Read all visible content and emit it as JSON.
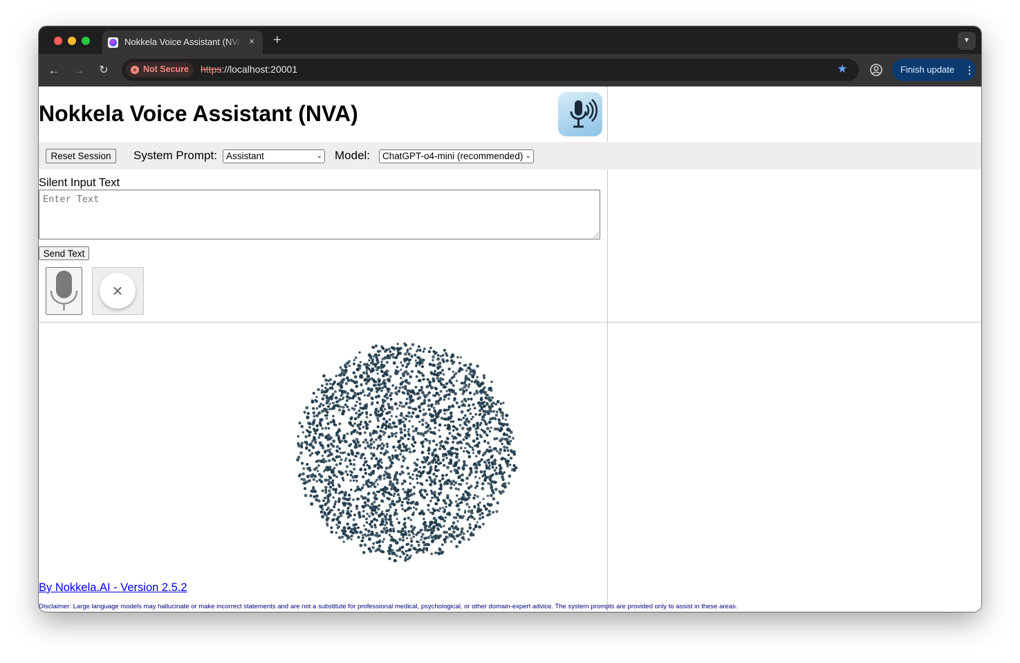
{
  "browser": {
    "tab_title": "Nokkela Voice Assistant (NVA)",
    "tab_close": "×",
    "new_tab": "+",
    "tab_dropdown": "⌄",
    "security_label": "Not Secure",
    "url_scheme": "https",
    "url_rest": "://localhost:20001",
    "update_label": "Finish update",
    "icons": {
      "back": "←",
      "forward": "→",
      "reload": "↻",
      "bookmark": "★",
      "menu": "⋮"
    }
  },
  "app": {
    "title": "Nokkela Voice Assistant (NVA)",
    "logo_icon": "microphone-soundwave-icon",
    "controls": {
      "reset_label": "Reset Session",
      "system_prompt_label": "System Prompt:",
      "system_prompt_value": "Assistant",
      "model_label": "Model:",
      "model_value": "ChatGPT-o4-mini (recommended)"
    },
    "silent_input": {
      "label": "Silent Input Text",
      "placeholder": "Enter Text",
      "value": ""
    },
    "send_label": "Send Text",
    "mic_icon": "microphone-icon",
    "cancel_icon": "close-icon",
    "cancel_glyph": "×",
    "visualization": "particle-sphere",
    "footer_link": "By Nokkela.AI - Version 2.5.2",
    "disclaimer": "Disclaimer: Large language models may hallucinate or make incorrect statements and are not a substitute for professional medical, psychological, or other domain-expert advice. The system prompts are provided only to assist in these areas."
  },
  "colors": {
    "link": "#0000ee",
    "disclaimer": "#000080",
    "accent_update": "#0b3a6e",
    "insecure": "#f28b82",
    "particle": "#1f3a4a"
  }
}
